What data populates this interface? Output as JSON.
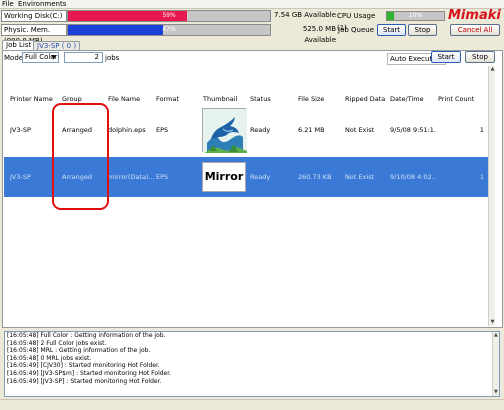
{
  "menu": {
    "file": "File",
    "environments": "Environments"
  },
  "status": {
    "working_disk_label": "Working Disk(C:)",
    "working_disk_pct": "59%",
    "working_disk_fill": 0.59,
    "working_disk_avail": "7.54 GB Available",
    "phys_mem_label": "Physic. Mem. (990.8 MB)",
    "phys_mem_pct": "47%",
    "phys_mem_fill": 0.47,
    "phys_mem_avail": "525.0 MB Available",
    "cpu_label": "CPU Usage (1)",
    "cpu_pct": "10%",
    "cpu_fill": 0.12,
    "job_queue_label": "Job Queue",
    "start_label": "Start",
    "stop_label": "Stop",
    "cancel_all_label": "Cancel All",
    "logo_text": "Mimaki"
  },
  "tabs": [
    {
      "label": "Job List"
    },
    {
      "label": "JV3-SP ( 0 )"
    }
  ],
  "toolbar": {
    "mode_label": "Mode",
    "mode_value": "Full Color",
    "jobs_count": "2",
    "jobs_label": "jobs",
    "auto_execution_label": "Auto Execution",
    "start_label": "Start",
    "stop_label": "Stop"
  },
  "table": {
    "headers": [
      "Printer Name",
      "Group",
      "File Name",
      "Format",
      "Thumbnail",
      "Status",
      "File Size",
      "Ripped Data",
      "Date/Time",
      "Print Count"
    ],
    "rows": [
      {
        "printer": "JV3-SP",
        "group": "Arranged",
        "file": "dolphin.eps",
        "format": "EPS",
        "thumbnail": "dolphin",
        "status": "Ready",
        "size": "6.21 MB",
        "ripped": "Not Exist",
        "datetime": "9/5/08 9:51:1...",
        "count": "1"
      },
      {
        "printer": "JV3-SP",
        "group": "Arranged",
        "file": "mirror(Data)...",
        "format": "EPS",
        "thumbnail": "Mirror",
        "status": "Ready",
        "size": "260.73 KB",
        "ripped": "Not Exist",
        "datetime": "9/10/08 4:02...",
        "count": "1"
      }
    ]
  },
  "log": [
    "[16:05:48] Full Color : Getting information of the job.",
    "[16:05:48] 2 Full Color jobs exist.",
    "[16:05:48] MRL : Getting information of the job.",
    "[16:05:48] 0 MRL jobs exist.",
    "[16:05:49] [CJV30] : Started monitoring Hot Folder.",
    "[16:05:49] [JV3-SP$m] : Started monitoring Hot Folder.",
    "[16:05:49] [JV3-SP] : Started monitoring Hot Folder."
  ],
  "colors": {
    "disk_fill": "#e8174f",
    "mem_fill": "#1c3fd6",
    "cpu_fill": "#2cb62c",
    "selected_row": "#3a79d6",
    "highlight": "#e01010"
  }
}
